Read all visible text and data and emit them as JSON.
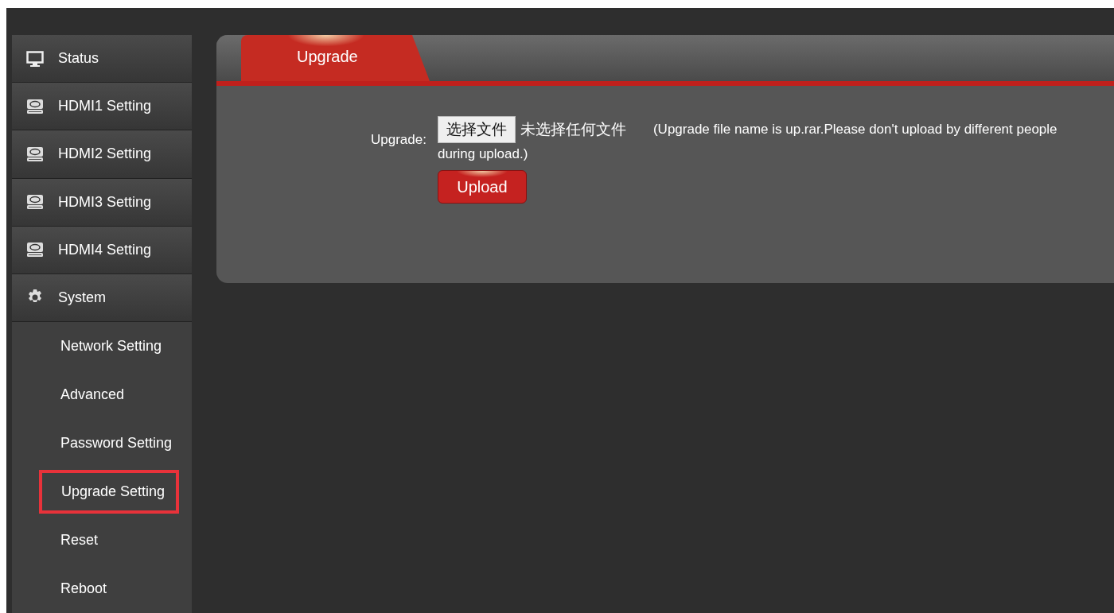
{
  "sidebar": {
    "items": [
      {
        "label": "Status",
        "kind": "monitor"
      },
      {
        "label": "HDMI1 Setting",
        "kind": "device"
      },
      {
        "label": "HDMI2 Setting",
        "kind": "device"
      },
      {
        "label": "HDMI3 Setting",
        "kind": "device"
      },
      {
        "label": "HDMI4 Setting",
        "kind": "device"
      },
      {
        "label": "System",
        "kind": "gear",
        "children": [
          {
            "label": "Network Setting",
            "highlighted": false
          },
          {
            "label": "Advanced",
            "highlighted": false
          },
          {
            "label": "Password Setting",
            "highlighted": false
          },
          {
            "label": "Upgrade Setting",
            "highlighted": true
          },
          {
            "label": "Reset",
            "highlighted": false
          },
          {
            "label": "Reboot",
            "highlighted": false
          }
        ]
      }
    ]
  },
  "panel": {
    "tabs": [
      {
        "label": "Upgrade",
        "selected": true
      }
    ],
    "form": {
      "label": "Upgrade:",
      "file_button": "选择文件",
      "file_status": "未选择任何文件",
      "hint_lines": [
        "(Upgrade file name is up.rar.Please don't upload by different people",
        "during upload.)"
      ],
      "submit": "Upload"
    }
  }
}
